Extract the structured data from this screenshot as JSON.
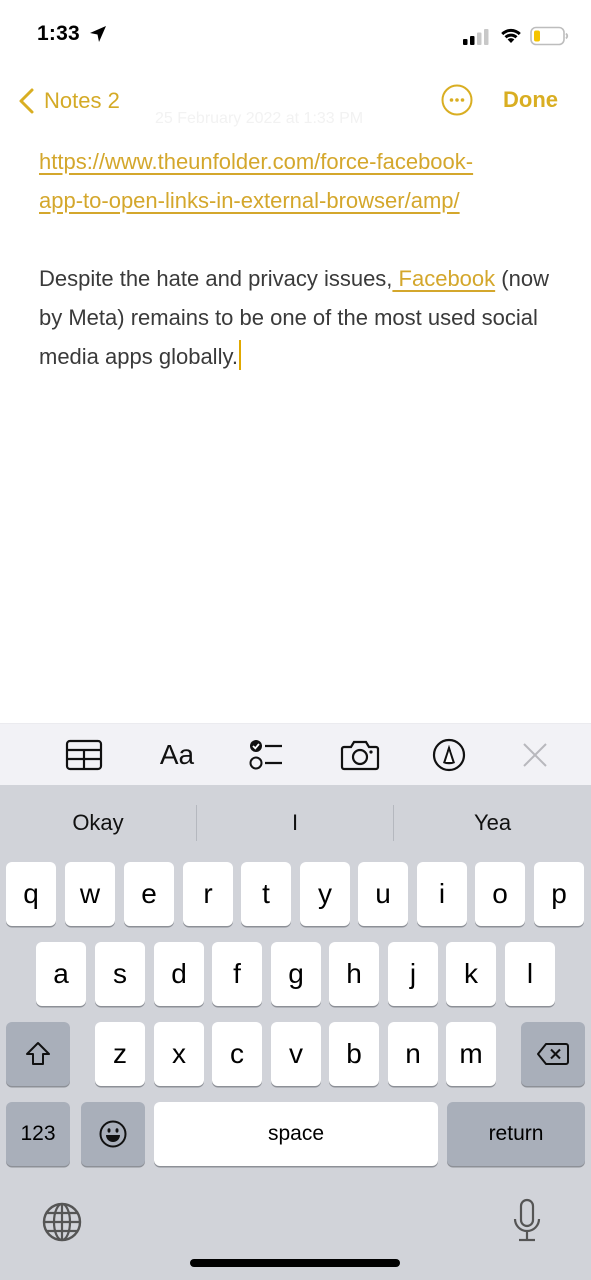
{
  "status_bar": {
    "time": "1:33",
    "icons": [
      "location-arrow-icon",
      "cellular-signal-icon",
      "wifi-icon",
      "battery-low-icon"
    ],
    "signal_bars_active": 2,
    "signal_bars_total": 4,
    "battery_level": 0.2,
    "battery_color": "#f5c400"
  },
  "nav": {
    "back_label": "Notes 2",
    "date": "25 February 2022 at 1:33 PM",
    "more_icon": "ellipsis-circle-icon",
    "done_label": "Done",
    "accent_color": "#d9ae22"
  },
  "note": {
    "link_line1": "https://www.theunfolder.com/force-facebook-",
    "link_line2": "app-to-open-links-in-external-browser/amp/",
    "body_before_link": "Despite the hate and privacy issues,",
    "body_link": " Facebook",
    "body_after_link": " (now by Meta) remains to be one of the most used social media apps globally."
  },
  "toolbar": {
    "items": [
      {
        "name": "table",
        "icon": "table-icon"
      },
      {
        "name": "format",
        "label": "Aa"
      },
      {
        "name": "checklist",
        "icon": "checklist-icon"
      },
      {
        "name": "camera",
        "icon": "camera-icon"
      },
      {
        "name": "markup",
        "icon": "markup-pen-icon"
      },
      {
        "name": "close",
        "icon": "close-icon"
      }
    ]
  },
  "keyboard": {
    "predictions": [
      "Okay",
      "I",
      "Yea"
    ],
    "row1": [
      "q",
      "w",
      "e",
      "r",
      "t",
      "y",
      "u",
      "i",
      "o",
      "p"
    ],
    "row2": [
      "a",
      "s",
      "d",
      "f",
      "g",
      "h",
      "j",
      "k",
      "l"
    ],
    "row3": [
      "z",
      "x",
      "c",
      "v",
      "b",
      "n",
      "m"
    ],
    "numbers_label": "123",
    "space_label": "space",
    "return_label": "return",
    "shift_icon": "shift-icon",
    "delete_icon": "delete-backward-icon",
    "emoji_icon": "emoji-icon",
    "globe_icon": "globe-icon",
    "mic_icon": "microphone-icon"
  }
}
